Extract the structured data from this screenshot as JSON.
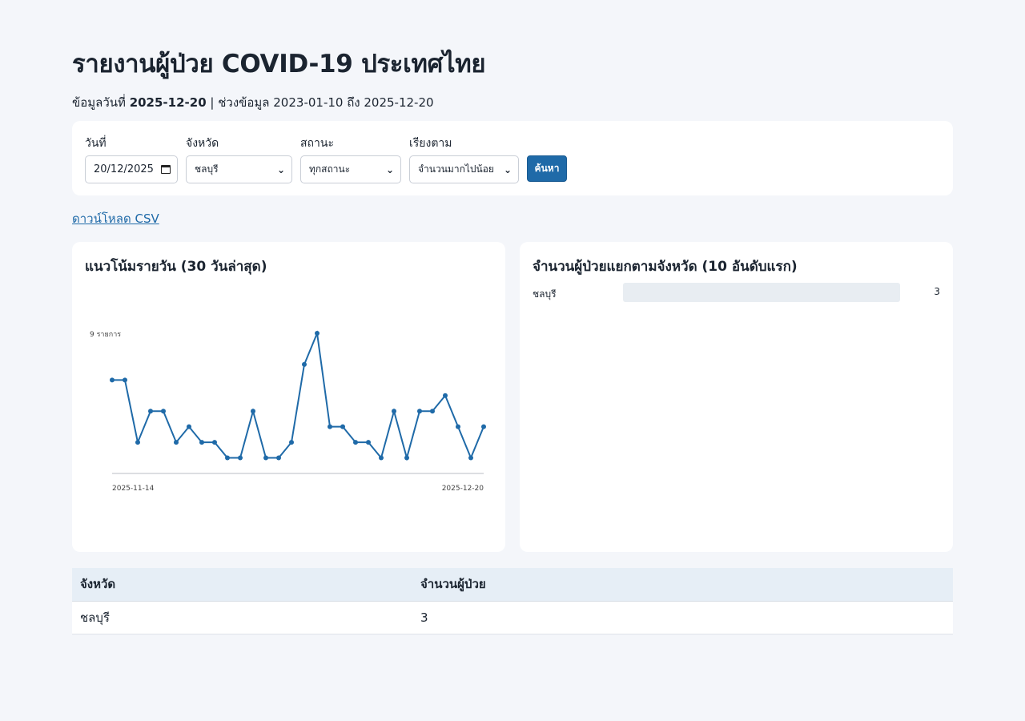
{
  "page": {
    "title": "รายงานผู้ป่วย COVID-19 ประเทศไทย",
    "subtitle_prefix": "ข้อมูลวันที่ ",
    "subtitle_date": "2025-12-20",
    "subtitle_suffix": " | ช่วงข้อมูล 2023-01-10 ถึง 2025-12-20"
  },
  "filters": {
    "date_label": "วันที่",
    "date_value": "20/12/2025",
    "province_label": "จังหวัด",
    "province_value": "ชลบุรี",
    "status_label": "สถานะ",
    "status_value": "ทุกสถานะ",
    "sort_label": "เรียงตาม",
    "sort_value": "จำนวนมากไปน้อย",
    "search_button": "ค้นหา"
  },
  "download_link": "ดาวน์โหลด CSV",
  "trend_card": {
    "title": "แนวโน้มรายวัน (30 วันล่าสุด)"
  },
  "province_card": {
    "title": "จำนวนผู้ป่วยแยกตามจังหวัด (10 อันดับแรก)",
    "bars": [
      {
        "label": "ชลบุรี",
        "value": "3",
        "fraction": 0
      }
    ]
  },
  "table": {
    "headers": [
      "จังหวัด",
      "จำนวนผู้ป่วย"
    ],
    "rows": [
      [
        "ชลบุรี",
        "3"
      ]
    ]
  },
  "colors": {
    "accent": "#1f6aa8",
    "background": "#f4f6fa"
  },
  "chart_data": {
    "type": "line",
    "x_start_label": "2025-11-14",
    "x_end_label": "2025-12-20",
    "max_label": "9 รายการ",
    "max_value": 9,
    "values": [
      6,
      6,
      2,
      4,
      4,
      2,
      3,
      2,
      2,
      1,
      1,
      4,
      1,
      1,
      2,
      7,
      9,
      3,
      3,
      2,
      2,
      1,
      4,
      1,
      4,
      4,
      5,
      3,
      1,
      3
    ],
    "series_color": "#1f6aa8"
  }
}
